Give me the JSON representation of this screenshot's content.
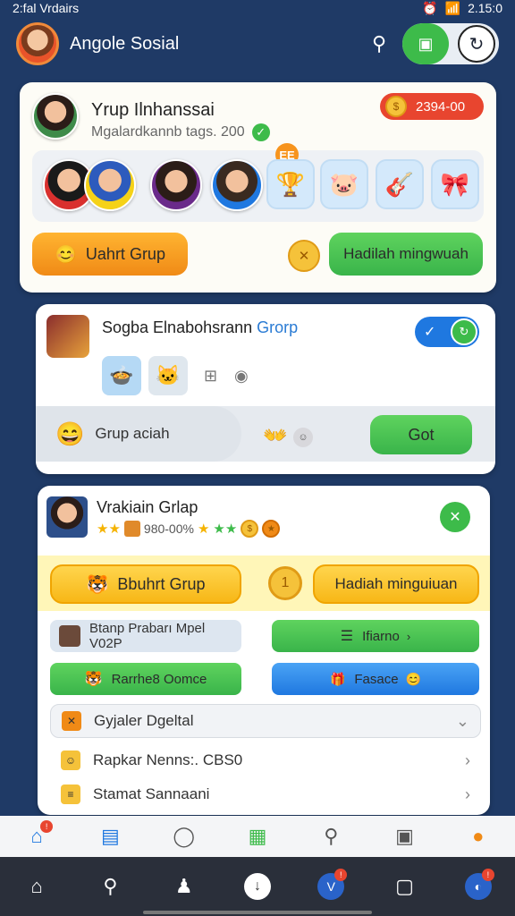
{
  "status": {
    "left": "2:fal Vrdairs",
    "right": "2.15:0"
  },
  "appbar": {
    "title": "Angole Sosial"
  },
  "group_card": {
    "title": "Yrup Ilnhanssai",
    "subtitle": "Mgalardkannb tags. 200",
    "coin_value": "2394-00",
    "new_badge": "EE",
    "join_button": "Uahrt Grup",
    "reward_button": "Hadilah mingwuah"
  },
  "second_card": {
    "title_main": "Sogba Elnabohsrann",
    "title_accent": "Grorp",
    "action_label": "Grup aciah",
    "go_button": "Got"
  },
  "third_card": {
    "title": "Vrakiain Grlap",
    "rating_text": "980-00%",
    "join_button": "Bbuhrt Grup",
    "reward_button": "Hadiah minguiuan",
    "row_left_1": "Btanp Prabarı Mpel V02P",
    "row_right_1": "Ifiarno",
    "row_left_2": "Rarrhe8 Oomce",
    "row_right_2": "Fasace",
    "list": [
      {
        "label": "Gyjaler Dgeltal"
      },
      {
        "label": "Rapkar Nenns:. CBS0"
      },
      {
        "label": "Stamat Sannaani"
      }
    ]
  },
  "colors": {
    "accent_green": "#3dbb4a",
    "accent_orange": "#f08a16",
    "accent_blue": "#1f78e0",
    "background": "#1f3a66"
  }
}
